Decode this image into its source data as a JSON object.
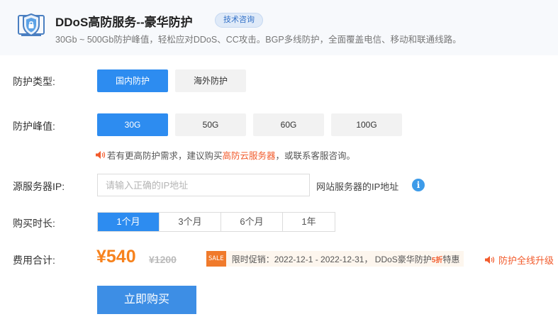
{
  "header": {
    "title": "DDoS高防服务--豪华防护",
    "consult_label": "技术咨询",
    "subtitle": "30Gb ~ 500Gb防护峰值，轻松应对DDoS、CC攻击。BGP多线防护，全面覆盖电信、移动和联通线路。"
  },
  "protection_type": {
    "label": "防护类型:",
    "options": [
      "国内防护",
      "海外防护"
    ],
    "selected": "国内防护"
  },
  "peak": {
    "label": "防护峰值:",
    "options": [
      "30G",
      "50G",
      "60G",
      "100G"
    ],
    "selected": "30G",
    "note_prefix": "若有更高防护需求，建议购买",
    "note_link": "高防云服务器",
    "note_suffix": "，或联系客服咨询。"
  },
  "source_ip": {
    "label": "源服务器IP:",
    "placeholder": "请输入正确的IP地址",
    "value": "",
    "hint": "网站服务器的IP地址",
    "info_glyph": "i"
  },
  "duration": {
    "label": "购买时长:",
    "options": [
      "1个月",
      "3个月",
      "6个月",
      "1年"
    ],
    "selected": "1个月"
  },
  "cost": {
    "label": "费用合计:",
    "price": "¥540",
    "original_price": "¥1200",
    "sale_badge": "SALE",
    "promo_text": "限时促销：2022-12-1 - 2022-12-31， DDoS豪华防护",
    "promo_discount": "5折",
    "promo_tail": "特惠",
    "upgrade_label": "防护全线升级"
  },
  "buy_button": "立即购买",
  "colors": {
    "accent_blue": "#2d8cf0",
    "price_orange": "#f7821d",
    "promo_red": "#f25b2c"
  },
  "icons": [
    "shield-icon",
    "speaker-icon",
    "info-icon"
  ]
}
